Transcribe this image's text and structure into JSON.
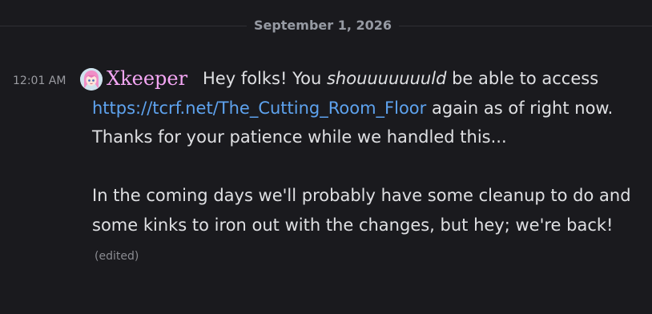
{
  "divider": {
    "date": "September 1, 2026"
  },
  "message": {
    "timestamp": "12:01 AM",
    "author": "Xkeeper",
    "line1_pre": "Hey folks! You ",
    "line1_em": "shouuuuuuuld",
    "line1_post": " be able to access ",
    "link_text": "https://tcrf.net/The_Cutting_Room_Floor",
    "line1_end": " again as of right now. Thanks for your patience while we handled this...",
    "paragraph2": "In the coming days we'll probably have some cleanup to do and some kinks to iron out with the changes, but hey; we're back!",
    "edited_label": "(edited)"
  },
  "colors": {
    "background": "#1a1a1e",
    "username": "#f4a6f4",
    "link": "#5ea3ef",
    "text": "#dfe0e3"
  },
  "icons": {
    "avatar": "anime-girl-avatar"
  }
}
